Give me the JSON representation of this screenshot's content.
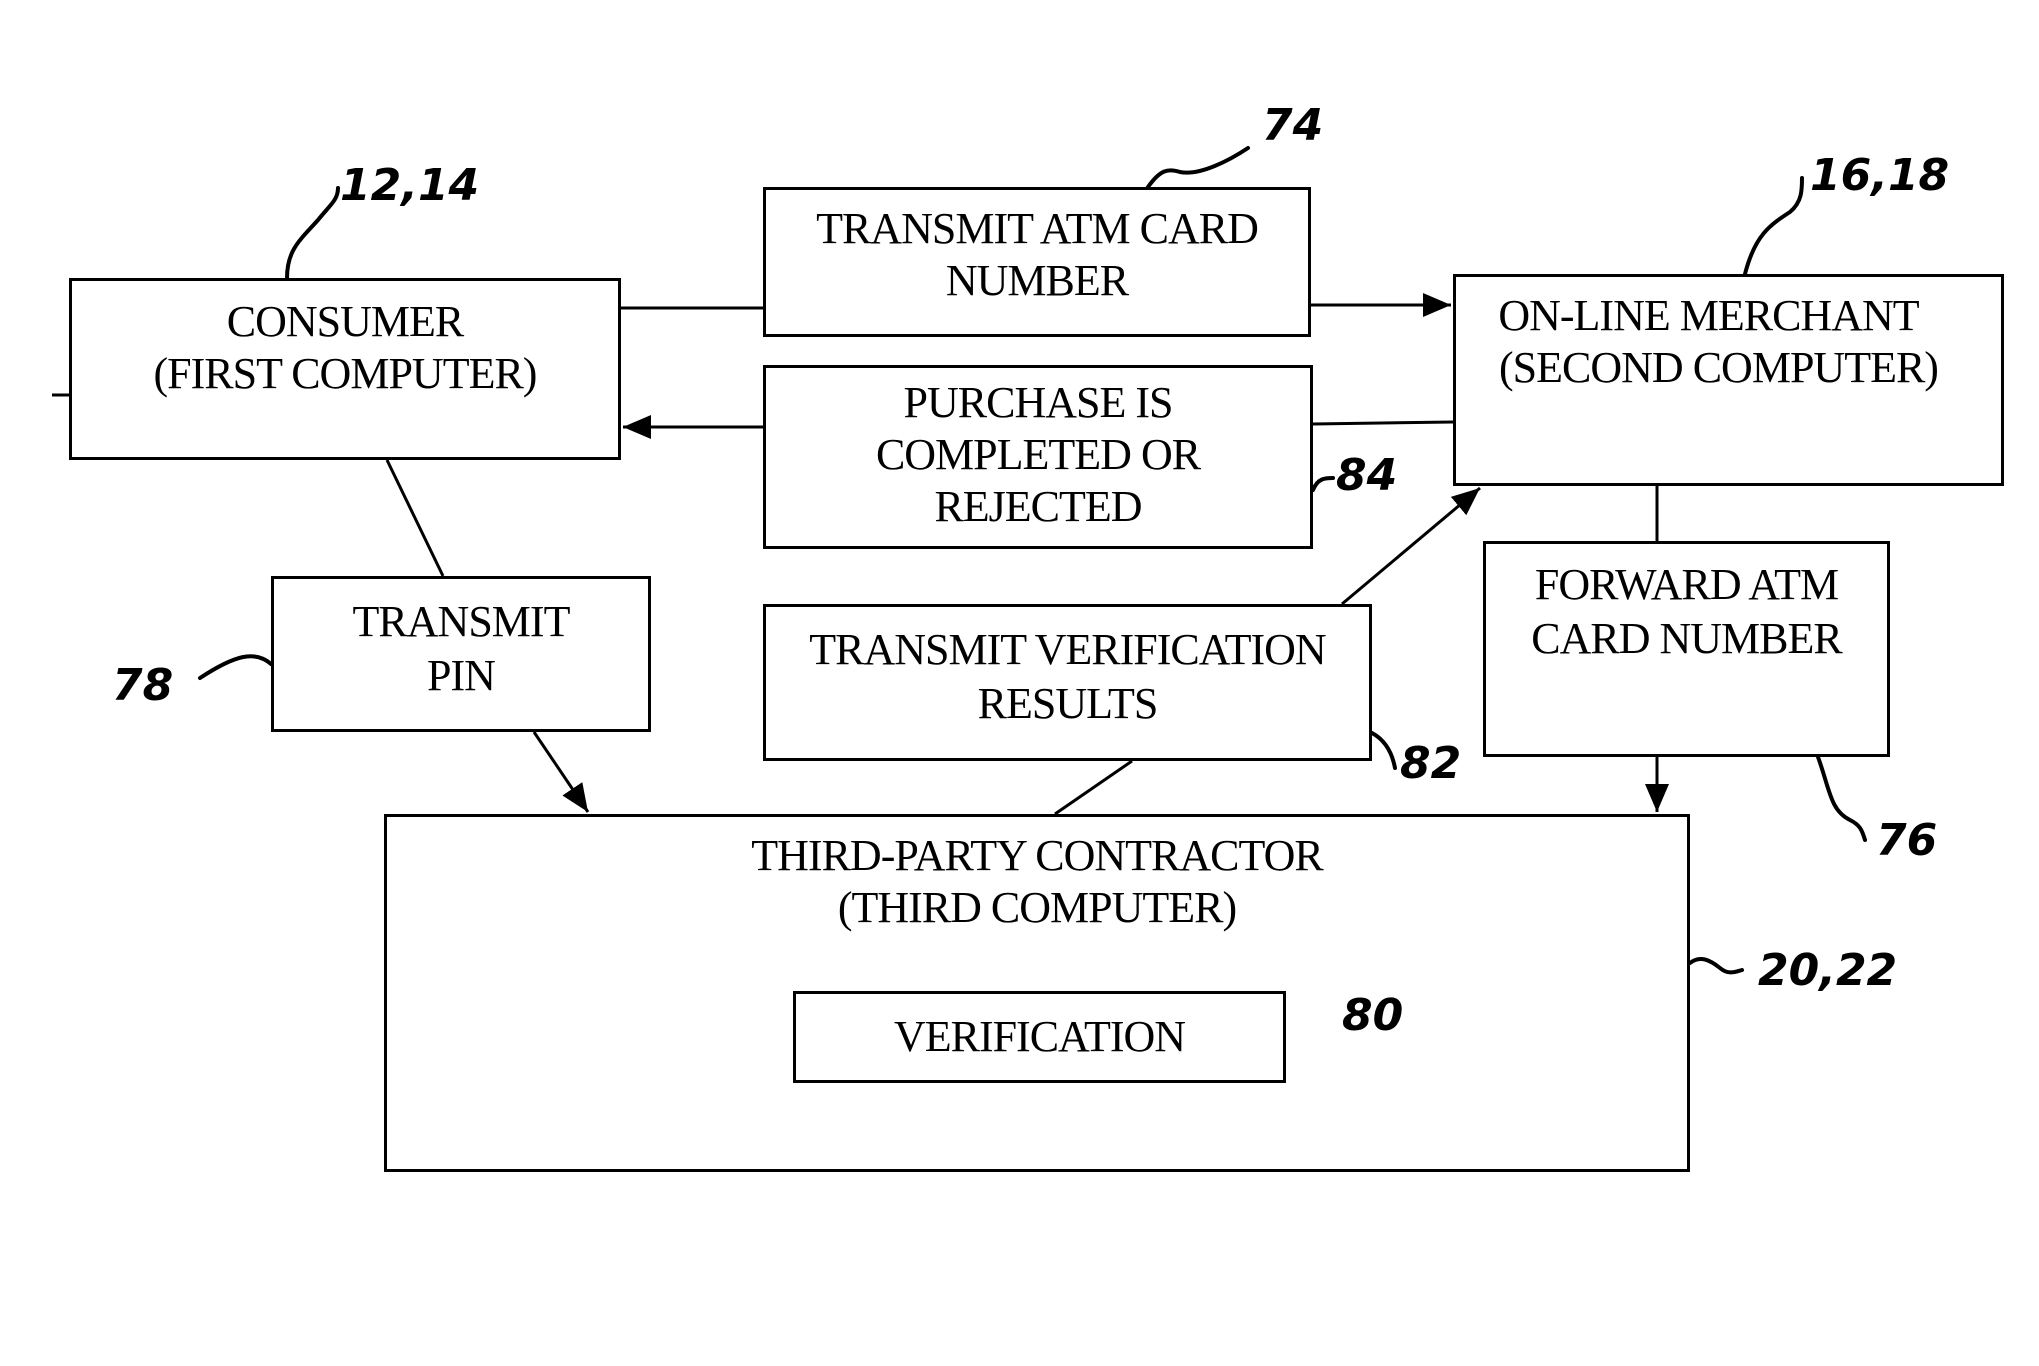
{
  "diagram": {
    "nodes": {
      "consumer": {
        "lines": [
          "CONSUMER",
          "(FIRST COMPUTER)"
        ],
        "ref": "12,14"
      },
      "transmit_atm": {
        "lines": [
          "TRANSMIT ATM CARD",
          "NUMBER"
        ],
        "ref": "74"
      },
      "purchase": {
        "lines": [
          "PURCHASE IS",
          "COMPLETED OR",
          "REJECTED"
        ],
        "ref": "84"
      },
      "merchant": {
        "lines": [
          "ON-LINE MERCHANT",
          "(SECOND COMPUTER)"
        ],
        "ref": "16,18"
      },
      "transmit_pin": {
        "lines": [
          "TRANSMIT",
          "PIN"
        ],
        "ref": "78"
      },
      "transmit_verification": {
        "lines": [
          "TRANSMIT VERIFICATION",
          "RESULTS"
        ],
        "ref": "82"
      },
      "forward_atm": {
        "lines": [
          "FORWARD ATM",
          "CARD NUMBER"
        ],
        "ref": "76"
      },
      "third_party": {
        "lines": [
          "THIRD-PARTY CONTRACTOR",
          "(THIRD COMPUTER)"
        ],
        "ref": "20,22"
      },
      "verification": {
        "lines": [
          "VERIFICATION"
        ],
        "ref": "80"
      }
    },
    "edges": [
      {
        "from": "consumer",
        "via": "transmit_atm",
        "to": "merchant"
      },
      {
        "from": "merchant",
        "via": "purchase",
        "to": "consumer"
      },
      {
        "from": "consumer",
        "via": "transmit_pin",
        "to": "third_party"
      },
      {
        "from": "third_party",
        "via": "transmit_verification",
        "to": "merchant"
      },
      {
        "from": "merchant",
        "via": "forward_atm",
        "to": "third_party"
      }
    ]
  }
}
